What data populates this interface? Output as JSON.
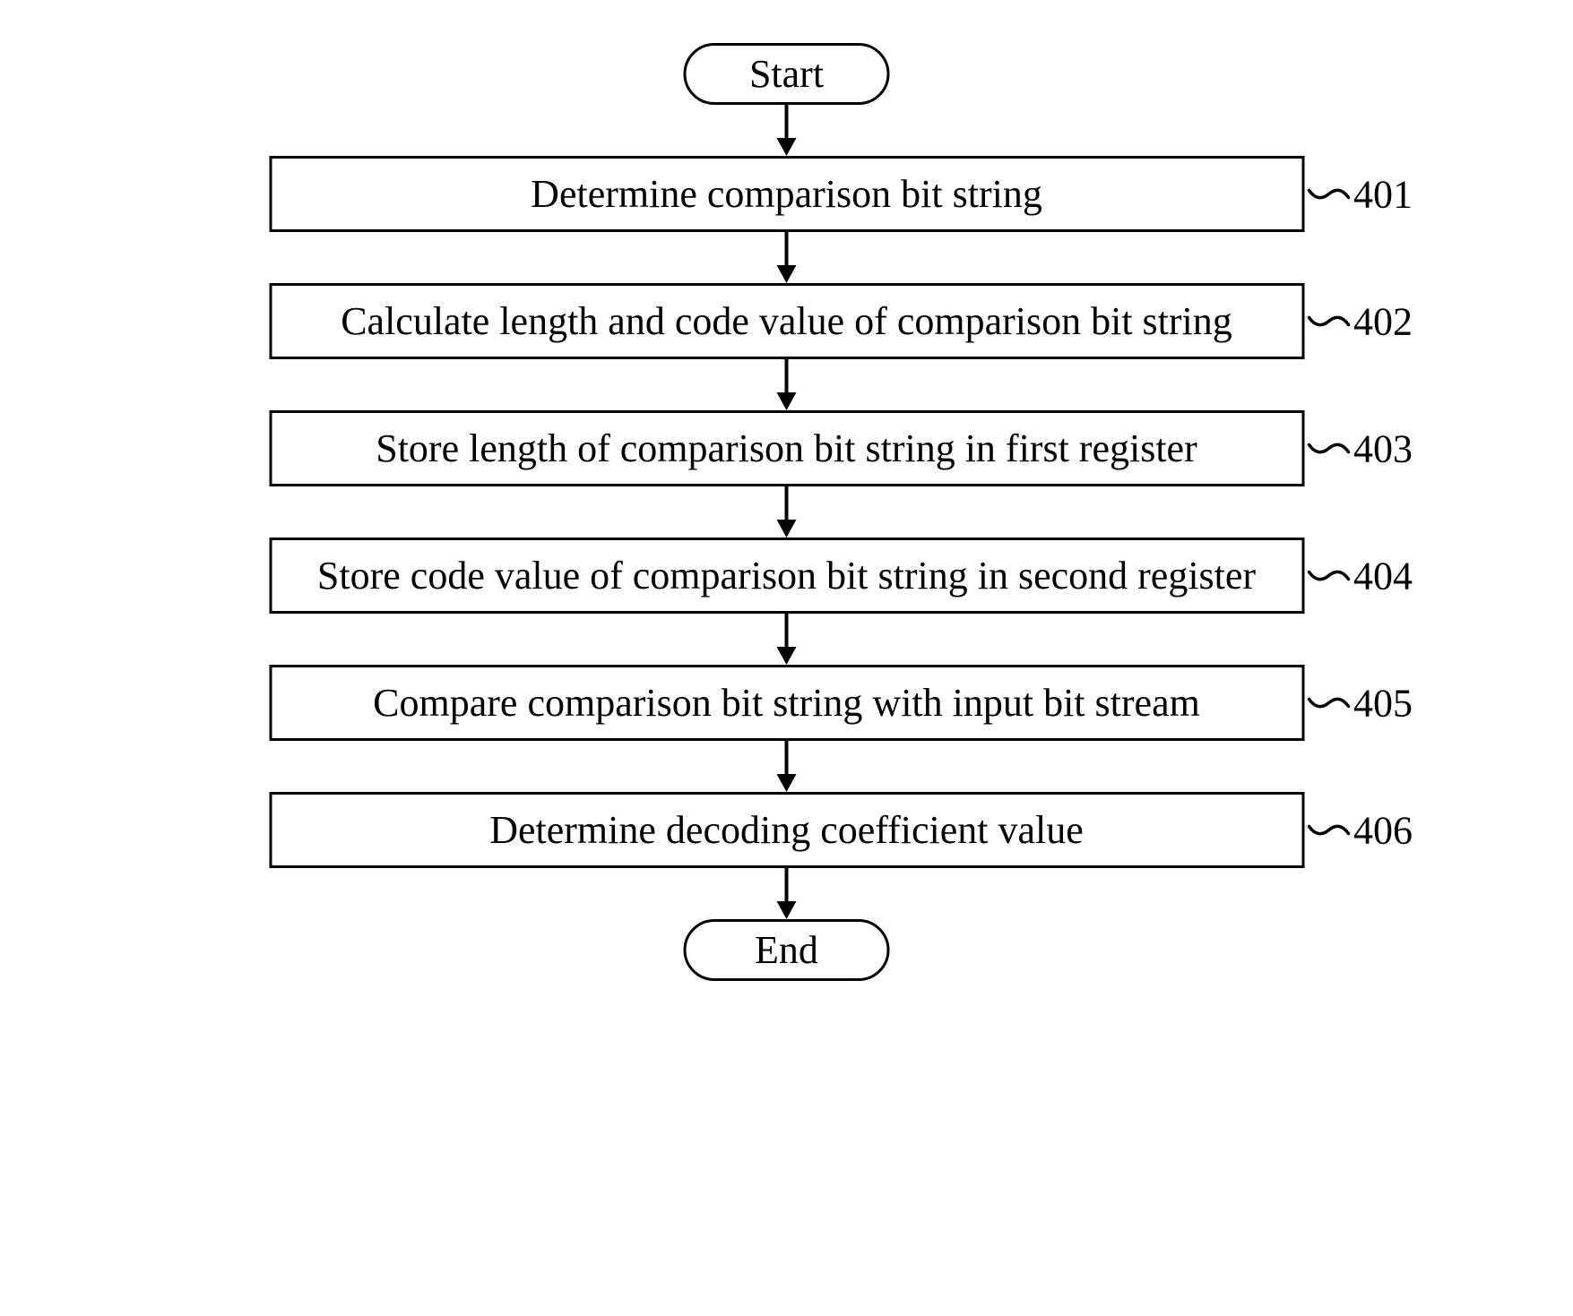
{
  "chart_data": {
    "type": "flowchart",
    "nodes": [
      {
        "id": "start",
        "type": "terminal",
        "label": "Start"
      },
      {
        "id": "s401",
        "type": "process",
        "label": "Determine comparison bit string",
        "ref": "401"
      },
      {
        "id": "s402",
        "type": "process",
        "label": "Calculate length and code value of comparison bit string",
        "ref": "402"
      },
      {
        "id": "s403",
        "type": "process",
        "label": "Store length of comparison bit string in first register",
        "ref": "403"
      },
      {
        "id": "s404",
        "type": "process",
        "label": "Store code value of comparison bit string in second register",
        "ref": "404"
      },
      {
        "id": "s405",
        "type": "process",
        "label": "Compare comparison bit string with input bit stream",
        "ref": "405"
      },
      {
        "id": "s406",
        "type": "process",
        "label": "Determine decoding coefficient value",
        "ref": "406"
      },
      {
        "id": "end",
        "type": "terminal",
        "label": "End"
      }
    ],
    "edges": [
      [
        "start",
        "s401"
      ],
      [
        "s401",
        "s402"
      ],
      [
        "s402",
        "s403"
      ],
      [
        "s403",
        "s404"
      ],
      [
        "s404",
        "s405"
      ],
      [
        "s405",
        "s406"
      ],
      [
        "s406",
        "end"
      ]
    ]
  },
  "terminals": {
    "start": "Start",
    "end": "End"
  },
  "steps": {
    "s401": {
      "label": "Determine comparison bit string",
      "ref": "401"
    },
    "s402": {
      "label": "Calculate length and code value of comparison bit string",
      "ref": "402"
    },
    "s403": {
      "label": "Store length of comparison bit string in first register",
      "ref": "403"
    },
    "s404": {
      "label": "Store code value of comparison bit string in second register",
      "ref": "404"
    },
    "s405": {
      "label": "Compare comparison bit string with input bit stream",
      "ref": "405"
    },
    "s406": {
      "label": "Determine decoding coefficient value",
      "ref": "406"
    }
  }
}
